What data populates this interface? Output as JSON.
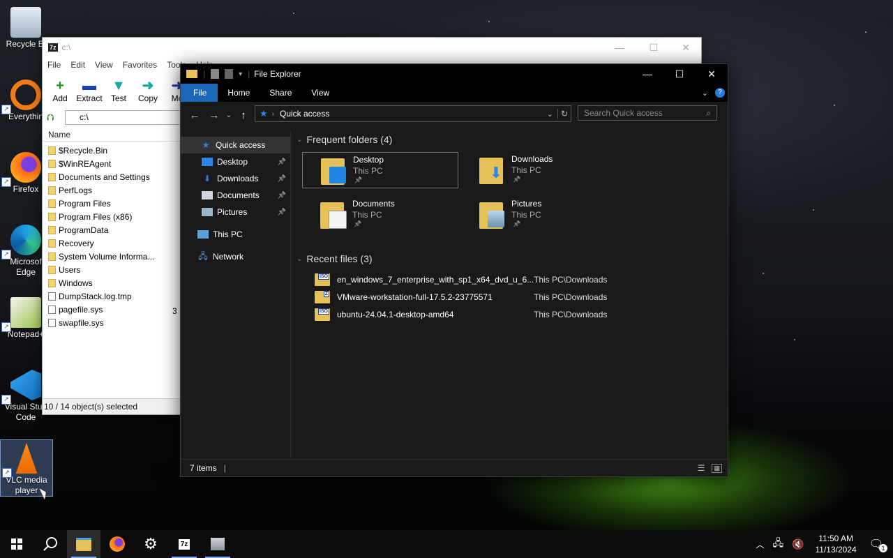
{
  "desktop": {
    "icons": [
      {
        "name": "recycle-bin",
        "label": "Recycle Bin",
        "display": "Recycle Bi"
      },
      {
        "name": "everything",
        "label": "Everything",
        "display": "Everythin"
      },
      {
        "name": "firefox",
        "label": "Firefox",
        "display": "Firefox"
      },
      {
        "name": "edge",
        "label": "Microsoft Edge",
        "display": "Microsof\nEdge"
      },
      {
        "name": "notepadpp",
        "label": "Notepad++",
        "display": "Notepad+"
      },
      {
        "name": "vscode",
        "label": "Visual Studio Code",
        "display": "Visual Stud\nCode"
      },
      {
        "name": "vlc",
        "label": "VLC media player",
        "display": "VLC media\nplayer"
      }
    ]
  },
  "sevenzip": {
    "title": "c:\\",
    "logo": "7z",
    "menu": [
      "File",
      "Edit",
      "View",
      "Favorites",
      "Tools",
      "Help"
    ],
    "tools": [
      {
        "label": "Add",
        "glyph": "+",
        "color": "#1a9a1a"
      },
      {
        "label": "Extract",
        "glyph": "▬",
        "color": "#1a3fb8"
      },
      {
        "label": "Test",
        "glyph": "▼",
        "color": "#19a8a0"
      },
      {
        "label": "Copy",
        "glyph": "➜",
        "color": "#19a8a0"
      },
      {
        "label": "Mo",
        "glyph": "➜",
        "color": "#1a3fb8"
      }
    ],
    "address": "c:\\",
    "column_header": "Name",
    "items": [
      {
        "name": "$Recycle.Bin",
        "type": "folder"
      },
      {
        "name": "$WinREAgent",
        "type": "folder"
      },
      {
        "name": "Documents and Settings",
        "type": "folder"
      },
      {
        "name": "PerfLogs",
        "type": "folder"
      },
      {
        "name": "Program Files",
        "type": "folder"
      },
      {
        "name": "Program Files (x86)",
        "type": "folder"
      },
      {
        "name": "ProgramData",
        "type": "folder"
      },
      {
        "name": "Recovery",
        "type": "folder"
      },
      {
        "name": "System Volume Informa...",
        "type": "folder"
      },
      {
        "name": "Users",
        "type": "folder"
      },
      {
        "name": "Windows",
        "type": "folder"
      },
      {
        "name": "DumpStack.log.tmp",
        "type": "file"
      },
      {
        "name": "pagefile.sys",
        "type": "file"
      },
      {
        "name": "swapfile.sys",
        "type": "file"
      }
    ],
    "status": "10 / 14 object(s) selected"
  },
  "explorer": {
    "title": "File Explorer",
    "ribbon_tabs": [
      "File",
      "Home",
      "Share",
      "View"
    ],
    "address": "Quick access",
    "search_placeholder": "Search Quick access",
    "sidebar": [
      {
        "label": "Quick access",
        "icon": "star-icon",
        "pinned": false,
        "selected": true
      },
      {
        "label": "Desktop",
        "icon": "desktop-icon",
        "pinned": true,
        "selected": false
      },
      {
        "label": "Downloads",
        "icon": "download-icon",
        "pinned": true,
        "selected": false
      },
      {
        "label": "Documents",
        "icon": "documents-icon",
        "pinned": true,
        "selected": false
      },
      {
        "label": "Pictures",
        "icon": "pictures-icon",
        "pinned": true,
        "selected": false
      },
      {
        "label": "This PC",
        "icon": "computer-icon",
        "pinned": false,
        "selected": false
      },
      {
        "label": "Network",
        "icon": "network-icon",
        "pinned": false,
        "selected": false
      }
    ],
    "frequent_title": "Frequent folders (4)",
    "frequent": [
      {
        "name": "Desktop",
        "location": "This PC",
        "selected": true
      },
      {
        "name": "Downloads",
        "location": "This PC",
        "selected": false
      },
      {
        "name": "Documents",
        "location": "This PC",
        "selected": false
      },
      {
        "name": "Pictures",
        "location": "This PC",
        "selected": false
      }
    ],
    "recent_title": "Recent files (3)",
    "recent": [
      {
        "name": "en_windows_7_enterprise_with_sp1_x64_dvd_u_6...",
        "location": "This PC\\Downloads",
        "badge": "ISO"
      },
      {
        "name": "VMware-workstation-full-17.5.2-23775571",
        "location": "This PC\\Downloads",
        "badge": "Z"
      },
      {
        "name": "ubuntu-24.04.1-desktop-amd64",
        "location": "This PC\\Downloads",
        "badge": "ISO"
      }
    ],
    "status": "7 items"
  },
  "taskbar": {
    "time": "11:50 AM",
    "date": "11/13/2024",
    "notification_count": "1"
  }
}
